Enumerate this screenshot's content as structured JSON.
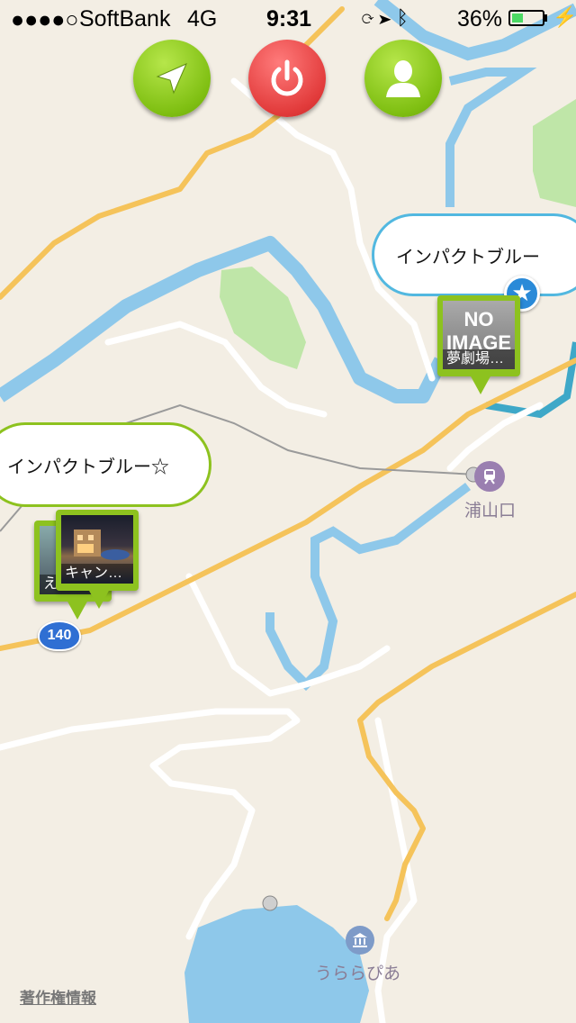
{
  "status_bar": {
    "signal": "●●●●○",
    "carrier": "SoftBank",
    "network": "4G",
    "time": "9:31",
    "battery": "36%",
    "battery_level": 0.36
  },
  "toolbar": {
    "locate_icon": "navigation-arrow-icon",
    "power_icon": "power-icon",
    "user_icon": "user-icon",
    "colors": {
      "green": "#8dc21f",
      "red": "#e23b3b"
    }
  },
  "map": {
    "colors": {
      "land": "#f3eee4",
      "water": "#8ec8ea",
      "park": "#bfe6a8",
      "road_major": "#f5c35a",
      "road_minor": "#ffffff"
    },
    "callouts": [
      {
        "title": "インパクトブルー",
        "pin_caption": "夢劇場…",
        "pin_image": "NO IMAGE",
        "ring_color": "#52b8e0"
      },
      {
        "title": "インパクトブルー☆",
        "pin_caption": "キャン…",
        "pin_caption_behind": "えこ…",
        "ring_color": "#8dc21f"
      }
    ],
    "labels": {
      "station": "浦山口",
      "museum": "うららぴあ",
      "route_shield": "140"
    },
    "no_image": {
      "line1": "NO",
      "line2": "IMAGE"
    }
  },
  "copyright": "著作権情報"
}
